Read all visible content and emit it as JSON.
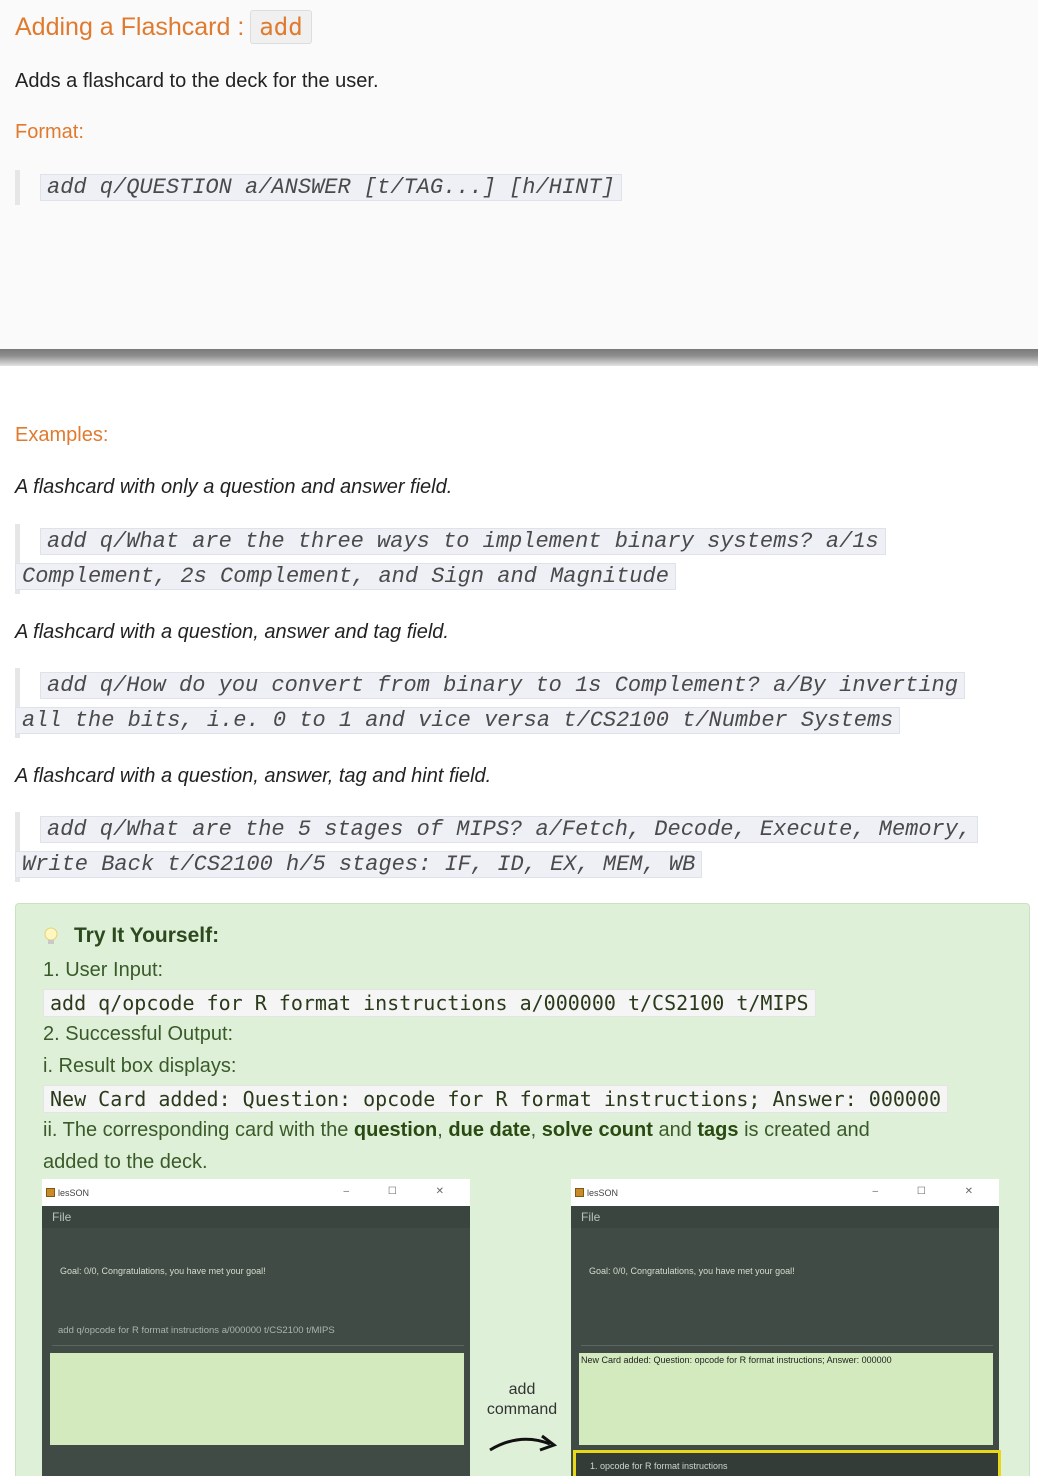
{
  "header": {
    "title": "Adding a Flashcard :",
    "command": "add"
  },
  "description": "Adds a flashcard to the deck for the user.",
  "format": {
    "label": "Format:",
    "syntax": "add q/QUESTION a/ANSWER [t/TAG...] [h/HINT]"
  },
  "examples": {
    "label": "Examples:",
    "items": [
      {
        "caption": "A flashcard with only a question and answer field.",
        "lines": [
          "add q/What are the three ways to implement binary systems? a/1s",
          "Complement, 2s Complement, and Sign and Magnitude"
        ]
      },
      {
        "caption": "A flashcard with a question, answer and tag field.",
        "lines": [
          "add q/How do you convert from binary to 1s Complement? a/By inverting",
          "all the bits, i.e. 0 to 1 and vice versa t/CS2100 t/Number Systems"
        ]
      },
      {
        "caption": "A flashcard with a question, answer, tag and hint field.",
        "lines": [
          "add q/What are the 5 stages of MIPS? a/Fetch, Decode, Execute, Memory,",
          "Write Back t/CS2100 h/5 stages: IF, ID, EX, MEM, WB"
        ]
      }
    ]
  },
  "tip": {
    "heading": "Try It Yourself:",
    "step1": "1. User Input:",
    "input_code": "add q/opcode for R format instructions a/000000 t/CS2100 t/MIPS",
    "step2": "2. Successful Output:",
    "step2a": "i. Result box displays:",
    "result_code": "New Card added: Question: opcode for R format instructions; Answer: 000000",
    "step2b_pre": "ii. The corresponding card with the ",
    "b1": "question",
    "sep1": ", ",
    "b2": "due date",
    "sep2": ", ",
    "b3": "solve count",
    "mid": " and ",
    "b4": "tags",
    "post": " is created and",
    "step2b_line2": "added to the deck."
  },
  "screenshots": {
    "app_name": "lesSON",
    "menu": "File",
    "window_controls": "– ☐ ✕",
    "goal": "Goal: 0/0, Congratulations, you have met your goal!",
    "before_input": "add q/opcode for R format instructions a/000000 t/CS2100 t/MIPS",
    "after_result": "New Card added: Question: opcode for R format instructions; Answer: 000000",
    "card_text": "1.   opcode for R format instructions",
    "arrow_label_1": "add",
    "arrow_label_2": "command"
  }
}
